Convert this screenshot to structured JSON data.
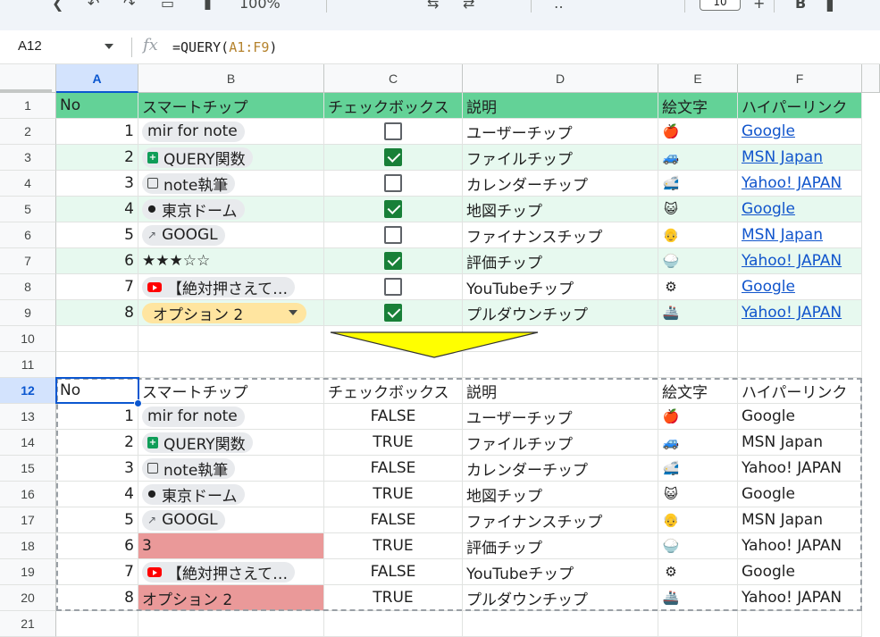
{
  "toolbar": {
    "zoom": "100%",
    "font_size": "10",
    "bold": "B"
  },
  "formula_bar": {
    "cell_ref": "A12",
    "fx": "fx",
    "formula_prefix": "=QUERY(",
    "formula_ref": "A1:F9",
    "formula_suffix": ")"
  },
  "columns": [
    "A",
    "B",
    "C",
    "D",
    "E",
    "F"
  ],
  "rows": [
    "1",
    "2",
    "3",
    "4",
    "5",
    "6",
    "7",
    "8",
    "9",
    "10",
    "11",
    "12",
    "13",
    "14",
    "15",
    "16",
    "17",
    "18",
    "19",
    "20",
    "21"
  ],
  "header": {
    "no": "No",
    "smartchip": "スマートチップ",
    "checkbox": "チェックボックス",
    "desc": "説明",
    "emoji": "絵文字",
    "link": "ハイパーリンク"
  },
  "source": [
    {
      "no": "1",
      "chip": "mir for note",
      "chip_icon": "none",
      "checked": false,
      "desc": "ユーザーチップ",
      "emoji": "🍎",
      "emoji_icon": "apple-icon",
      "link": "Google"
    },
    {
      "no": "2",
      "chip": "QUERY関数",
      "chip_icon": "sheets-icon",
      "checked": true,
      "desc": "ファイルチップ",
      "emoji": "🚙",
      "emoji_icon": "car-icon",
      "link": "MSN Japan"
    },
    {
      "no": "3",
      "chip": "note執筆",
      "chip_icon": "calendar-icon",
      "checked": false,
      "desc": "カレンダーチップ",
      "emoji": "🚅",
      "emoji_icon": "train-icon",
      "link": "Yahoo! JAPAN"
    },
    {
      "no": "4",
      "chip": "東京ドーム",
      "chip_icon": "map-pin-icon",
      "checked": true,
      "desc": "地図チップ",
      "emoji": "😺",
      "emoji_icon": "cat-icon",
      "link": "Google"
    },
    {
      "no": "5",
      "chip": "GOOGL",
      "chip_icon": "finance-icon",
      "checked": false,
      "desc": "ファイナンスチップ",
      "emoji": "👴",
      "emoji_icon": "person-icon",
      "link": "MSN Japan"
    },
    {
      "no": "6",
      "chip": "★★★☆☆",
      "chip_icon": "none",
      "checked": true,
      "desc": "評価チップ",
      "emoji": "🍚",
      "emoji_icon": "rice-icon",
      "link": "Yahoo! JAPAN"
    },
    {
      "no": "7",
      "chip": "【絶対押さえて…",
      "chip_icon": "youtube-icon",
      "checked": false,
      "desc": "YouTubeチップ",
      "emoji": "⚙",
      "emoji_icon": "gear-icon",
      "link": "Google"
    },
    {
      "no": "8",
      "chip": "オプション 2",
      "chip_icon": "dropdown",
      "checked": true,
      "desc": "プルダウンチップ",
      "emoji": "🚢",
      "emoji_icon": "ship-icon",
      "link": "Yahoo! JAPAN"
    }
  ],
  "result": [
    {
      "no": "1",
      "chip": "mir for note",
      "chip_icon": "none",
      "bool": "FALSE",
      "desc": "ユーザーチップ",
      "emoji": "🍎",
      "link": "Google"
    },
    {
      "no": "2",
      "chip": "QUERY関数",
      "chip_icon": "sheets-icon",
      "bool": "TRUE",
      "desc": "ファイルチップ",
      "emoji": "🚙",
      "link": "MSN Japan"
    },
    {
      "no": "3",
      "chip": "note執筆",
      "chip_icon": "calendar-icon",
      "bool": "FALSE",
      "desc": "カレンダーチップ",
      "emoji": "🚅",
      "link": "Yahoo! JAPAN"
    },
    {
      "no": "4",
      "chip": "東京ドーム",
      "chip_icon": "map-pin-icon",
      "bool": "TRUE",
      "desc": "地図チップ",
      "emoji": "😺",
      "link": "Google"
    },
    {
      "no": "5",
      "chip": "GOOGL",
      "chip_icon": "finance-icon",
      "bool": "FALSE",
      "desc": "ファイナンスチップ",
      "emoji": "👴",
      "link": "MSN Japan"
    },
    {
      "no": "6",
      "chip": "3",
      "chip_icon": "plain-error",
      "bool": "TRUE",
      "desc": "評価チップ",
      "emoji": "🍚",
      "link": "Yahoo! JAPAN"
    },
    {
      "no": "7",
      "chip": "【絶対押さえて…",
      "chip_icon": "youtube-icon",
      "bool": "FALSE",
      "desc": "YouTubeチップ",
      "emoji": "⚙",
      "link": "Google"
    },
    {
      "no": "8",
      "chip": "オプション 2",
      "chip_icon": "plain-error",
      "bool": "TRUE",
      "desc": "プルダウンチップ",
      "emoji": "🚢",
      "link": "Yahoo! JAPAN"
    }
  ],
  "colors": {
    "header_green": "#63d297",
    "band_green": "#e7f9ef",
    "error_red": "#ea9999",
    "arrow_yellow": "#ffff00",
    "link_blue": "#1155cc",
    "selection_blue": "#0b57d0"
  }
}
